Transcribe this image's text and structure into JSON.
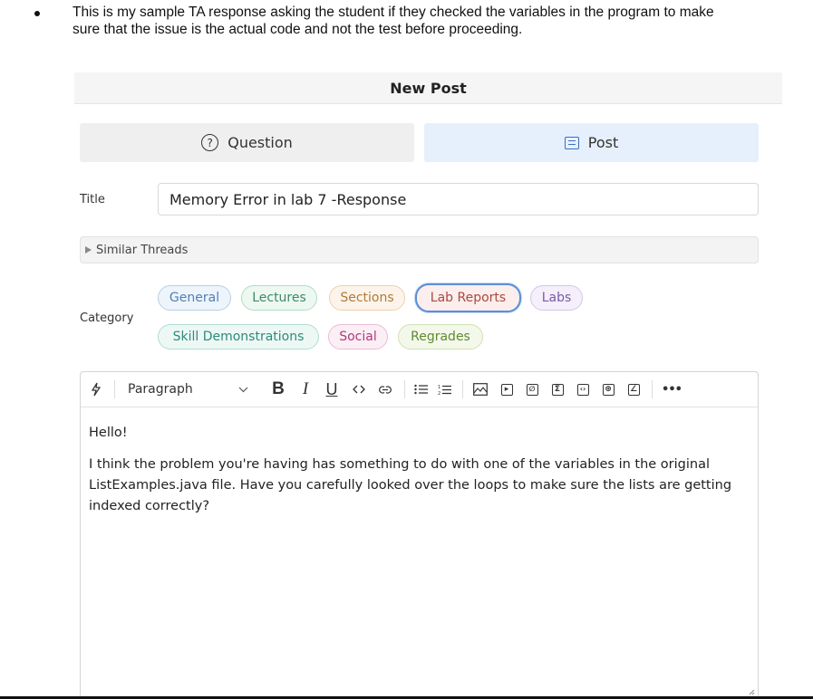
{
  "intro": {
    "text": "This is my sample TA response asking the student if they checked the variables in the program to make sure that the issue is the actual code and not the test before proceeding."
  },
  "editor": {
    "header": "New Post",
    "types": [
      {
        "label": "Question",
        "icon": "question-circle-icon",
        "selected": false
      },
      {
        "label": "Post",
        "icon": "post-icon",
        "selected": true
      }
    ],
    "title_label": "Title",
    "title_value": "Memory Error in lab 7 -Response",
    "similar_threads": "Similar Threads",
    "category_label": "Category",
    "categories": [
      {
        "label": "General",
        "color": "#4f7fb8",
        "bg": "#eef4fb",
        "selected": false
      },
      {
        "label": "Lectures",
        "color": "#3e8a66",
        "bg": "#eef8f2",
        "selected": false
      },
      {
        "label": "Sections",
        "color": "#b07a3a",
        "bg": "#fcf4ea",
        "selected": false
      },
      {
        "label": "Lab Reports",
        "color": "#a9493f",
        "bg": "#fbeeed",
        "selected": true
      },
      {
        "label": "Labs",
        "color": "#7a5aa8",
        "bg": "#f4effa",
        "selected": false
      },
      {
        "label": "Skill Demonstrations",
        "color": "#2e8a7a",
        "bg": "#edf8f5",
        "selected": false
      },
      {
        "label": "Social",
        "color": "#b03a7c",
        "bg": "#fbeef5",
        "selected": false
      },
      {
        "label": "Regrades",
        "color": "#5e8a30",
        "bg": "#f3f8ea",
        "selected": false
      }
    ],
    "toolbar": {
      "paragraph": "Paragraph",
      "bold": "B",
      "italic": "I",
      "underline": "U",
      "more": "•••"
    },
    "body": {
      "greeting": "Hello!",
      "paragraph": "I think the problem you're having has something to do with one of the variables in the original ListExamples.java file. Have you carefully looked over the loops to make sure the lists are getting indexed correctly?"
    }
  }
}
